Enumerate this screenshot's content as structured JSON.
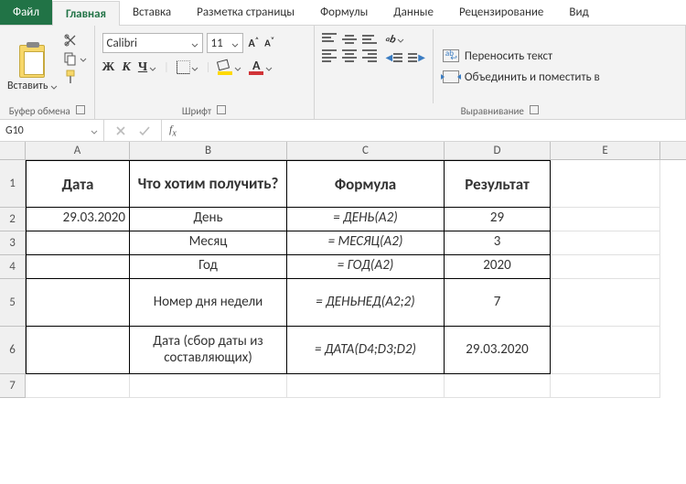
{
  "tabs": {
    "file": "Файл",
    "home": "Главная",
    "insert": "Вставка",
    "pagelayout": "Разметка страницы",
    "formulas": "Формулы",
    "data": "Данные",
    "review": "Рецензирование",
    "view": "Вид"
  },
  "ribbon": {
    "clipboard": {
      "paste": "Вставить",
      "title": "Буфер обмена"
    },
    "font": {
      "name": "Calibri",
      "size": "11",
      "bold": "Ж",
      "italic": "К",
      "underline": "Ч",
      "title": "Шрифт",
      "bigA": "А",
      "smallA": "А",
      "colorA": "А"
    },
    "alignment": {
      "wrap": "Переносить текст",
      "merge": "Объединить и поместить в",
      "rotateAb": "ab",
      "title": "Выравнивание"
    }
  },
  "namebox": "G10",
  "formula": "",
  "columns": [
    "A",
    "B",
    "C",
    "D",
    "E"
  ],
  "rows": [
    "1",
    "2",
    "3",
    "4",
    "5",
    "6",
    "7"
  ],
  "headers": {
    "A": "Дата",
    "B": "Что хотим получить?",
    "C": "Формула",
    "D": "Результат"
  },
  "data": {
    "r2": {
      "A": "29.03.2020",
      "B": "День",
      "C": "= ДЕНЬ(A2)",
      "D": "29"
    },
    "r3": {
      "A": "",
      "B": "Месяц",
      "C": "= МЕСЯЦ(A2)",
      "D": "3"
    },
    "r4": {
      "A": "",
      "B": "Год",
      "C": "= ГОД(A2)",
      "D": "2020"
    },
    "r5": {
      "A": "",
      "B": "Номер дня недели",
      "C": "= ДЕНЬНЕД(A2;2)",
      "D": "7"
    },
    "r6": {
      "A": "",
      "B": "Дата (сбор даты из составляющих)",
      "C": "= ДАТА(D4;D3;D2)",
      "D": "29.03.2020"
    }
  }
}
